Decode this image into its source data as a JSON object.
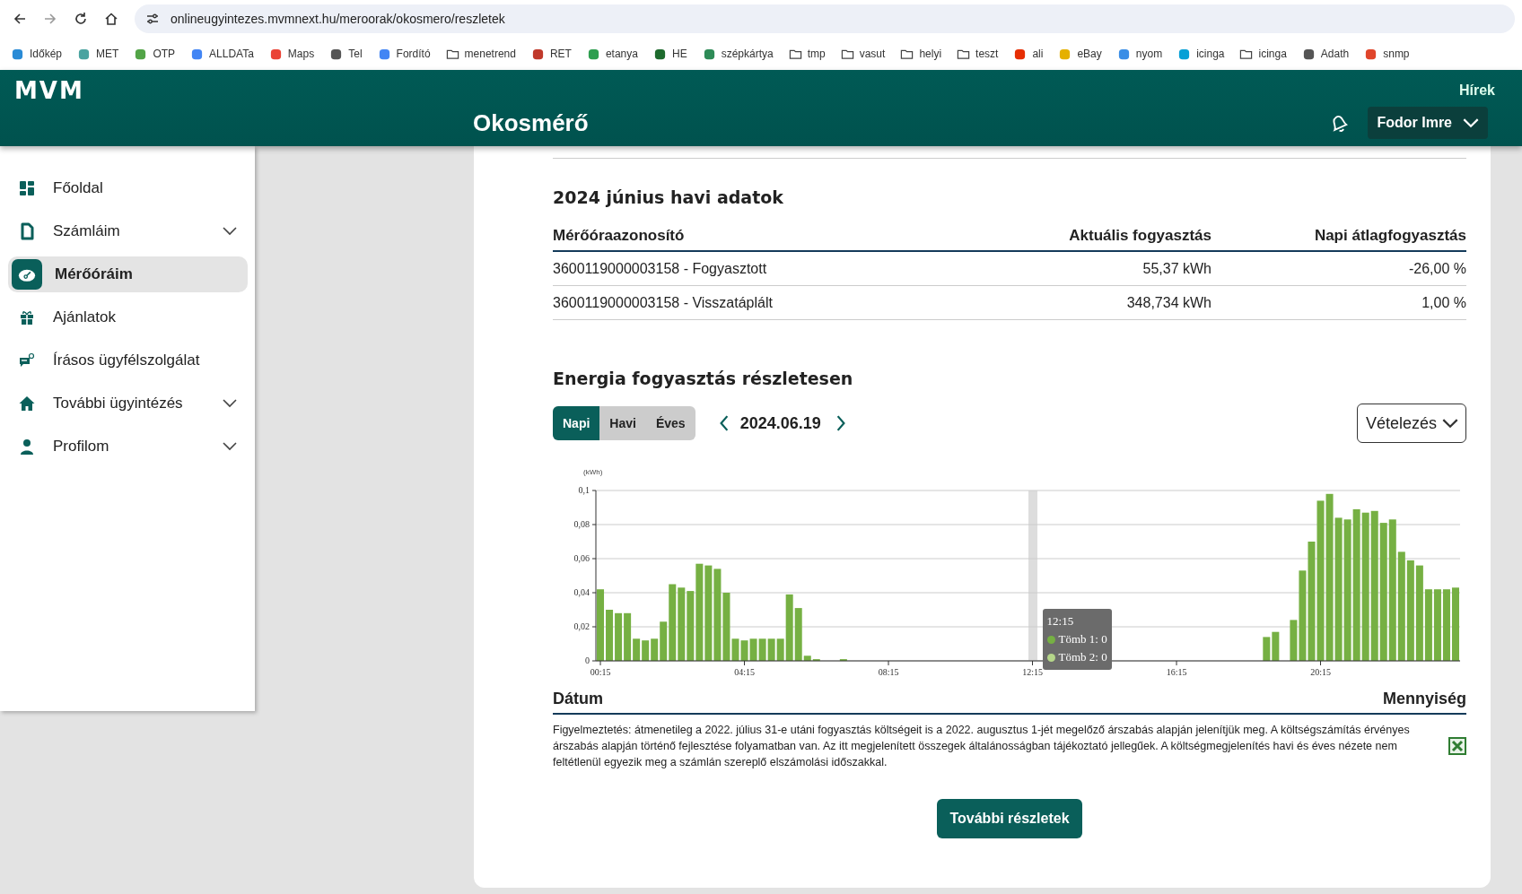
{
  "browser": {
    "url": "onlineugyintezes.mvmnext.hu/meroorak/okosmero/reszletek",
    "bookmarks": [
      {
        "label": "Időkép",
        "kind": "site",
        "color": "#2a8bd6"
      },
      {
        "label": "MET",
        "kind": "site",
        "color": "#4aa3a0"
      },
      {
        "label": "OTP",
        "kind": "site",
        "color": "#52a447"
      },
      {
        "label": "ALLDATa",
        "kind": "site",
        "color": "#4285f4"
      },
      {
        "label": "Maps",
        "kind": "site",
        "color": "#ea4335"
      },
      {
        "label": "Tel",
        "kind": "site",
        "color": "#555555"
      },
      {
        "label": "Fordító",
        "kind": "site",
        "color": "#4285f4"
      },
      {
        "label": "menetrend",
        "kind": "folder"
      },
      {
        "label": "RET",
        "kind": "site",
        "color": "#c0392b"
      },
      {
        "label": "etanya",
        "kind": "site",
        "color": "#2e9e4f"
      },
      {
        "label": "HE",
        "kind": "site",
        "color": "#1e6b2e"
      },
      {
        "label": "szépkártya",
        "kind": "site",
        "color": "#2e8b57"
      },
      {
        "label": "tmp",
        "kind": "folder"
      },
      {
        "label": "vasut",
        "kind": "folder"
      },
      {
        "label": "helyi",
        "kind": "folder"
      },
      {
        "label": "teszt",
        "kind": "folder"
      },
      {
        "label": "ali",
        "kind": "site",
        "color": "#e62e04"
      },
      {
        "label": "eBay",
        "kind": "site",
        "color": "#e5b000"
      },
      {
        "label": "nyom",
        "kind": "site",
        "color": "#3a8ee6"
      },
      {
        "label": "icinga",
        "kind": "site",
        "color": "#06a0d6"
      },
      {
        "label": "icinga",
        "kind": "folder"
      },
      {
        "label": "Adath",
        "kind": "site",
        "color": "#555555"
      },
      {
        "label": "snmp",
        "kind": "site",
        "color": "#e0452b"
      }
    ]
  },
  "header": {
    "logo": "MVM",
    "title": "Okosmérő",
    "news_link": "Hírek",
    "user": "Fodor Imre"
  },
  "sidebar": {
    "items": [
      {
        "label": "Főoldal",
        "kind": "grid",
        "selected": false,
        "submenu": false
      },
      {
        "label": "Számláim",
        "kind": "document",
        "selected": false,
        "submenu": true
      },
      {
        "label": "Mérőóráim",
        "kind": "meter",
        "selected": true,
        "submenu": false
      },
      {
        "label": "Ajánlatok",
        "kind": "gift",
        "selected": false,
        "submenu": false
      },
      {
        "label": "Írásos ügyfélszolgálat",
        "kind": "chat",
        "selected": false,
        "submenu": false
      },
      {
        "label": "További ügyintézés",
        "kind": "home",
        "selected": false,
        "submenu": true
      },
      {
        "label": "Profilom",
        "kind": "person",
        "selected": false,
        "submenu": true
      }
    ]
  },
  "monthly": {
    "title": "2024 június havi adatok",
    "columns": [
      "Mérőóraazonosító",
      "Aktuális fogyasztás",
      "Napi átlagfogyasztás"
    ],
    "rows": [
      [
        "3600119000003158 - Fogyasztott",
        "55,37 kWh",
        "-26,00 %"
      ],
      [
        "3600119000003158 - Visszatáplált",
        "348,734 kWh",
        "1,00 %"
      ]
    ]
  },
  "detail": {
    "title": "Energia fogyasztás részletesen",
    "periods": [
      {
        "label": "Napi",
        "selected": true
      },
      {
        "label": "Havi",
        "selected": false
      },
      {
        "label": "Éves",
        "selected": false
      }
    ],
    "date": "2024.06.19",
    "dropdown": "Vételezés",
    "chart_data": {
      "type": "bar",
      "ylabel": "(kWh)",
      "ylim": [
        0,
        0.1
      ],
      "yticks": [
        {
          "value": 0,
          "label": "0"
        },
        {
          "value": 0.02,
          "label": "0,02"
        },
        {
          "value": 0.04,
          "label": "0,04"
        },
        {
          "value": 0.06,
          "label": "0,06"
        },
        {
          "value": 0.08,
          "label": "0,08"
        },
        {
          "value": 0.1,
          "label": "0,1"
        }
      ],
      "grid": true,
      "xlim": [
        7.5,
        1447.5
      ],
      "x": [
        15,
        30,
        45,
        60,
        75,
        90,
        105,
        120,
        135,
        150,
        165,
        180,
        195,
        210,
        225,
        240,
        255,
        270,
        285,
        300,
        315,
        330,
        345,
        360,
        375,
        390,
        405,
        420,
        435,
        450,
        465,
        480,
        495,
        510,
        525,
        540,
        555,
        570,
        585,
        600,
        615,
        630,
        645,
        660,
        675,
        690,
        705,
        720,
        735,
        750,
        765,
        780,
        795,
        810,
        825,
        840,
        855,
        870,
        885,
        900,
        915,
        930,
        945,
        960,
        975,
        990,
        1005,
        1020,
        1035,
        1050,
        1065,
        1080,
        1095,
        1110,
        1125,
        1140,
        1155,
        1170,
        1185,
        1200,
        1215,
        1230,
        1245,
        1260,
        1275,
        1290,
        1305,
        1320,
        1335,
        1350,
        1365,
        1380,
        1395,
        1410,
        1425,
        1440
      ],
      "xticks": [
        {
          "value": 15,
          "label": "00:15"
        },
        {
          "value": 255,
          "label": "04:15"
        },
        {
          "value": 495,
          "label": "08:15"
        },
        {
          "value": 735,
          "label": "12:15"
        },
        {
          "value": 975,
          "label": "16:15"
        },
        {
          "value": 1215,
          "label": "20:15"
        }
      ],
      "series": [
        {
          "color": "#76b043",
          "values": [
            0.042,
            0.03,
            0.028,
            0.028,
            0.013,
            0.012,
            0.013,
            0.023,
            0.045,
            0.043,
            0.041,
            0.057,
            0.056,
            0.054,
            0.04,
            0.013,
            0.012,
            0.013,
            0.013,
            0.013,
            0.013,
            0.039,
            0.031,
            0.003,
            0.001,
            0,
            0,
            0.001,
            0,
            0,
            0,
            0,
            0,
            0,
            0,
            0,
            0,
            0,
            0,
            0,
            0,
            0,
            0,
            0,
            0,
            0,
            0,
            0,
            0,
            0,
            0,
            0,
            0,
            0,
            0,
            0,
            0,
            0,
            0,
            0,
            0,
            0,
            0,
            0,
            0,
            0,
            0,
            0,
            0,
            0,
            0,
            0,
            0,
            0,
            0.014,
            0.017,
            0,
            0.024,
            0.053,
            0.07,
            0.094,
            0.098,
            0.084,
            0.083,
            0.089,
            0.087,
            0.088,
            0.081,
            0.083,
            0.064,
            0.059,
            0.056,
            0.042,
            0.042,
            0.042,
            0.043
          ]
        }
      ]
    },
    "tooltip": {
      "time": "12:15",
      "items": [
        {
          "label": "Tömb 1: 0",
          "color": "#76b043"
        },
        {
          "label": "Tömb 2: 0",
          "color": "#b5d68a"
        }
      ]
    },
    "footer_columns": [
      "Dátum",
      "Mennyiség"
    ],
    "notice": "Figyelmeztetés: átmenetileg a 2022. július 31-e utáni fogyasztás költségeit is a 2022. augusztus 1-jét megelőző árszabás alapján jelenítjük meg. A költségszámítás érvényes árszabás alapján történő fejlesztése folyamatban van. Az itt megjelenített összegek általánosságban tájékoztató jellegűek. A költségmegjelenítés havi és éves nézete nem feltétlenül egyezik meg a számlán szereplő elszámolási időszakkal.",
    "more_button": "További részletek"
  }
}
